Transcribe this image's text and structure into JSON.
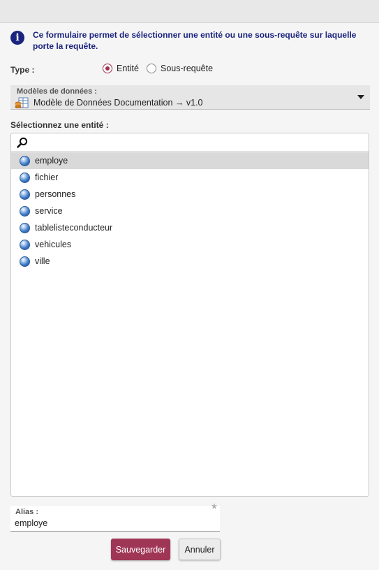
{
  "info": {
    "icon": "info-icon",
    "text": "Ce formulaire permet de sélectionner une entité ou une sous-requête sur laquelle porte la requête."
  },
  "type_field": {
    "label": "Type :",
    "options": [
      {
        "label": "Entité",
        "selected": true
      },
      {
        "label": "Sous-requête",
        "selected": false
      }
    ]
  },
  "model_select": {
    "label": "Modèles de données :",
    "icon": "data-model-icon",
    "value": "Modèle de Données Documentation → v1.0"
  },
  "entity_picker": {
    "title": "Sélectionnez une entité :",
    "search_value": "",
    "items": [
      {
        "label": "employe",
        "selected": true
      },
      {
        "label": "fichier",
        "selected": false
      },
      {
        "label": "personnes",
        "selected": false
      },
      {
        "label": "service",
        "selected": false
      },
      {
        "label": "tablelisteconducteur",
        "selected": false
      },
      {
        "label": "vehicules",
        "selected": false
      },
      {
        "label": "ville",
        "selected": false
      }
    ]
  },
  "alias_field": {
    "label": "Alias :",
    "value": "employe",
    "required_mark": "*"
  },
  "buttons": {
    "save": "Sauvegarder",
    "cancel": "Annuler"
  },
  "colors": {
    "accent": "#a03656",
    "info": "#1a237e",
    "selected_row": "#d9d9d9"
  }
}
